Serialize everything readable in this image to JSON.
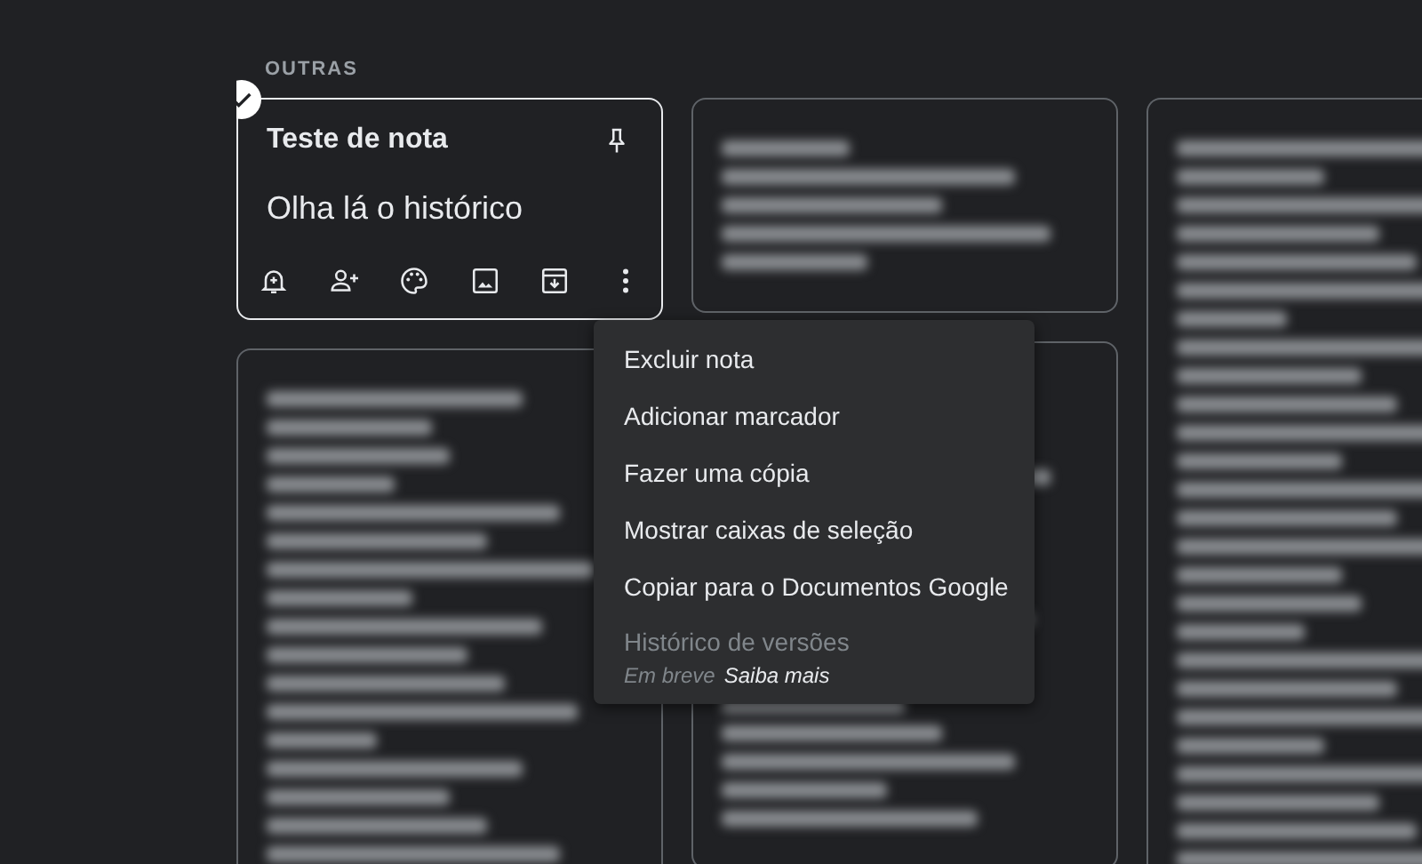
{
  "section_label": "OUTRAS",
  "columns": [
    {
      "notes": [
        {
          "kind": "note",
          "selected": true,
          "title": "Teste de nota",
          "body": "Olha lá o histórico",
          "pinned": false
        },
        {
          "kind": "blurred",
          "selected": false
        }
      ]
    },
    {
      "notes": [
        {
          "kind": "blurred",
          "selected": false
        },
        {
          "kind": "blurred",
          "selected": false
        }
      ]
    },
    {
      "notes": [
        {
          "kind": "blurred",
          "selected": false
        }
      ]
    }
  ],
  "menu": {
    "items": [
      {
        "label": "Excluir nota",
        "disabled": false
      },
      {
        "label": "Adicionar marcador",
        "disabled": false
      },
      {
        "label": "Fazer uma cópia",
        "disabled": false
      },
      {
        "label": "Mostrar caixas de seleção",
        "disabled": false
      },
      {
        "label": "Copiar para o Documentos Google",
        "disabled": false
      },
      {
        "label": "Histórico de versões",
        "disabled": true,
        "note": "Em breve",
        "link": "Saiba mais"
      }
    ]
  }
}
